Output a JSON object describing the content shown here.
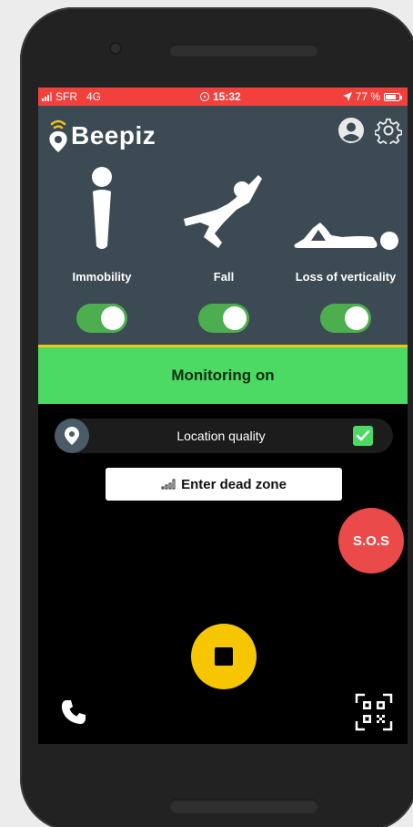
{
  "status_bar": {
    "carrier": "SFR",
    "network": "4G",
    "time": "15:32",
    "battery": "77 %",
    "battery_level_percent": 77,
    "background_color": "#f2403c"
  },
  "header": {
    "app_name": "Beepiz",
    "icons": [
      "account-icon",
      "settings-gear-icon"
    ],
    "background_color": "#3b4a53"
  },
  "modes": [
    {
      "label": "Immobility",
      "icon": "standing-person-icon",
      "enabled": true
    },
    {
      "label": "Fall",
      "icon": "falling-person-icon",
      "enabled": true
    },
    {
      "label": "Loss of verticality",
      "icon": "lying-person-icon",
      "enabled": true
    }
  ],
  "monitoring": {
    "label": "Monitoring on",
    "color": "#4cd964"
  },
  "location": {
    "label": "Location quality",
    "checked": true,
    "icon": "location-pin-icon"
  },
  "dead_zone": {
    "label": "Enter dead zone",
    "icon": "signal-bars-icon"
  },
  "sos": {
    "label": "S.O.S",
    "color": "#ea4a4a"
  },
  "stop": {
    "icon": "stop-icon",
    "color": "#f6c700"
  },
  "bottom": {
    "left_icon": "phone-icon",
    "right_icon": "qr-code-icon"
  }
}
